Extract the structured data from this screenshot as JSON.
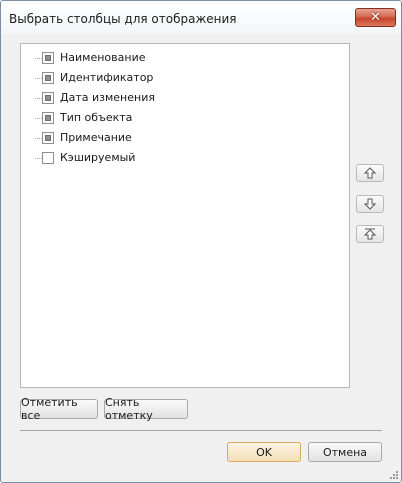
{
  "window": {
    "title": "Выбрать столбцы для отображения"
  },
  "columns": [
    {
      "label": "Наименование",
      "checked": true
    },
    {
      "label": "Идентификатор",
      "checked": true
    },
    {
      "label": "Дата изменения",
      "checked": true
    },
    {
      "label": "Тип объекта",
      "checked": true
    },
    {
      "label": "Примечание",
      "checked": true
    },
    {
      "label": "Кэшируемый",
      "checked": false
    }
  ],
  "side_buttons": [
    "arrow-up-icon",
    "arrow-down-icon",
    "arrow-top-icon"
  ],
  "buttons": {
    "select_all": "Отметить все",
    "deselect": "Снять отметку",
    "ok": "OK",
    "cancel": "Отмена"
  },
  "colors": {
    "close_button": "#c6452b",
    "default_button_border": "#d8a95a"
  }
}
